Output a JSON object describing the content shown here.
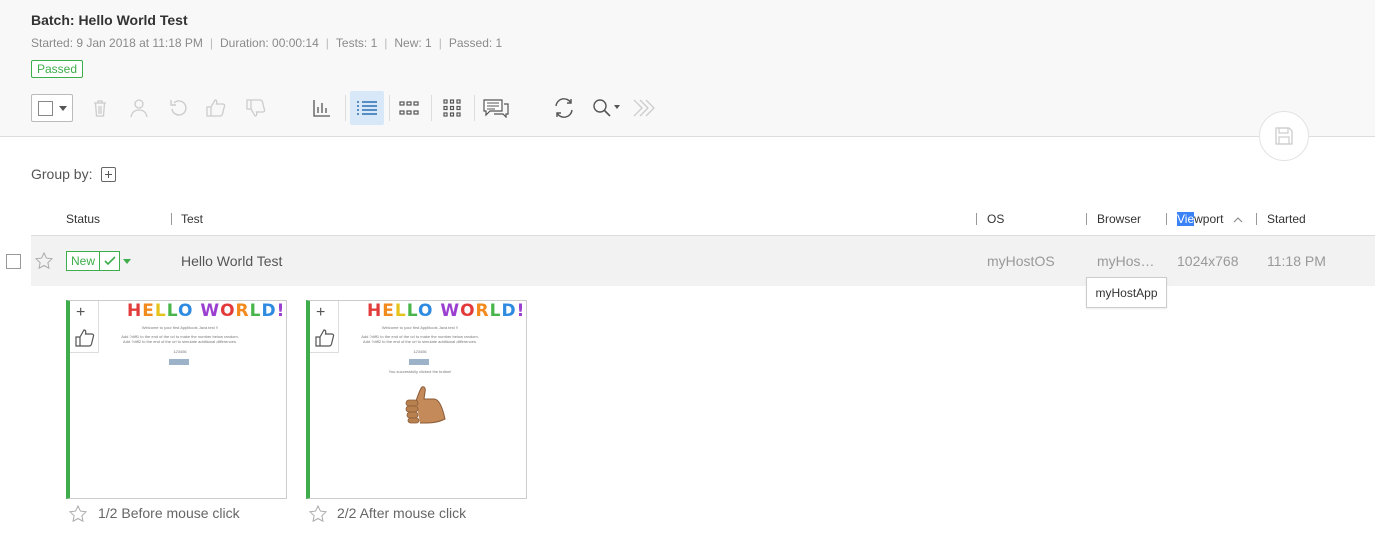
{
  "batch": {
    "title": "Batch: Hello World Test",
    "started": "Started: 9 Jan 2018 at 11:18 PM",
    "duration": "Duration: 00:00:14",
    "tests": "Tests: 1",
    "new": "New: 1",
    "passed": "Passed: 1",
    "status": "Passed"
  },
  "toolbar": {
    "icons": [
      "select-all-checkbox",
      "delete-icon",
      "assign-user-icon",
      "undo-icon",
      "thumbs-up-icon",
      "thumbs-down-icon",
      "bar-chart-icon",
      "list-view-icon",
      "grid-small-icon",
      "grid-large-icon",
      "comments-icon",
      "refresh-icon",
      "search-icon",
      "fast-forward-icon"
    ],
    "active": "list-view-icon"
  },
  "group_by": {
    "label": "Group by:"
  },
  "columns": {
    "status": "Status",
    "test": "Test",
    "os": "OS",
    "browser": "Browser",
    "viewport_highlighted": "Vie",
    "viewport_rest": "wport",
    "started": "Started"
  },
  "row": {
    "status": "New",
    "test": "Hello World Test",
    "os": "myHostOS",
    "browser": "myHos…",
    "viewport": "1024x768",
    "started": "11:18 PM"
  },
  "tooltip": {
    "text": "myHostApp"
  },
  "steps": [
    {
      "caption": "1/2 Before mouse click",
      "heading": "HELLO WORLD!",
      "line1": "Welcome to your first Applitools Java test !!",
      "line2": "Add ?diff1 to the end of the url to make the number below random.",
      "line3": "Add ?diff2 to the end of the url to simulate additional differences.",
      "number": "123456"
    },
    {
      "caption": "2/2 After mouse click",
      "heading": "HELLO WORLD!",
      "line1": "Welcome to your first Applitools Java test !!",
      "line2": "Add ?diff1 to the end of the url to make the number below random.",
      "line3": "Add ?diff2 to the end of the url to simulate additional differences.",
      "number": "123456",
      "clicked": "You successfully clicked the button!"
    }
  ],
  "colors": {
    "accent_green": "#3dae4b",
    "active_tool_bg": "#d8e8f8",
    "highlight_blue": "#3b82f6"
  }
}
